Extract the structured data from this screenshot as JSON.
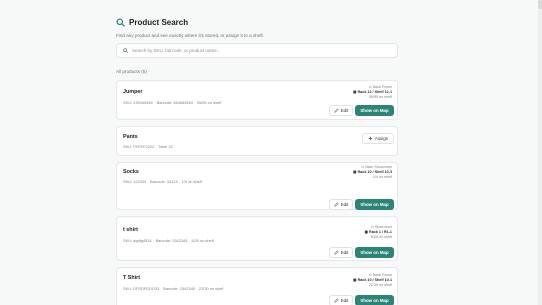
{
  "header": {
    "title": "Product Search",
    "subtitle": "Find any product and see exactly where it's stored, or assign it to a shelf."
  },
  "search": {
    "placeholder": "Search by SKU, barcode, or product name...",
    "value": ""
  },
  "results_label": "All products (5)",
  "actions": {
    "edit": "Edit",
    "show_on_map": "Show on Map",
    "assign": "Assign"
  },
  "products": [
    {
      "name": "Jumper",
      "sku": "SKU: 235345346",
      "barcode": "Barcode: 364564564",
      "stock": "95/95 on shelf",
      "room": "Back Room",
      "rack": "Rack 12 / Shelf 12-1",
      "rack_stock": "95/95 on shelf"
    },
    {
      "name": "Pants",
      "sku": "SKU: FEFEF2222",
      "total": "Total: 22"
    },
    {
      "name": "Socks",
      "sku": "SKU: 122343",
      "barcode": "Barcode: 34124",
      "stock": "1/4 on shelf",
      "room": "Main Showroom",
      "rack": "Rack 10 / Shelf 10-3",
      "rack_stock": "1/4 on shelf"
    },
    {
      "name": "t shirt",
      "sku": "SKU: dgdfg4524",
      "barcode": "Barcode: 2342345",
      "stock": "5/20 on shelf",
      "room": "Storeroom",
      "rack": "Rack 1 / R1-1",
      "rack_stock": "5/20 on shelf"
    },
    {
      "name": "T Shirt",
      "sku": "SKU: DFSDFDDG33",
      "barcode": "Barcode: 2342345",
      "stock": "22/30 on shelf",
      "room": "Back Room",
      "rack": "Rack 10 / Shelf 10-1",
      "rack_stock": "22/30 on shelf"
    }
  ],
  "colors": {
    "accent": "#2a8577",
    "background": "#f7f8f8",
    "card": "#ffffff"
  },
  "icons": {
    "title": "search-icon",
    "search": "search-icon",
    "location": "location-pin-icon",
    "rack": "rack-icon",
    "edit": "pencil-icon",
    "assign": "plus-icon"
  }
}
